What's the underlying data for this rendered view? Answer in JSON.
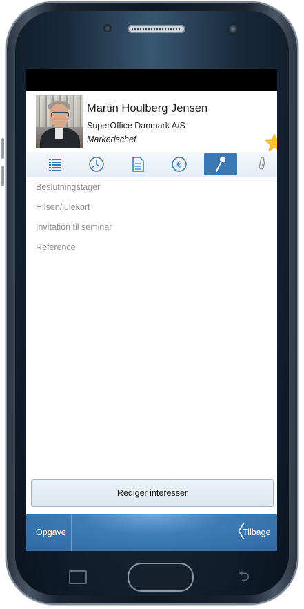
{
  "contact": {
    "name": "Martin Houlberg Jensen",
    "company": "SuperOffice Danmark A/S",
    "title": "Markedschef"
  },
  "tabs": [
    {
      "icon": "list-icon",
      "active": false
    },
    {
      "icon": "clock-icon",
      "active": false
    },
    {
      "icon": "document-icon",
      "active": false
    },
    {
      "icon": "euro-icon",
      "active": false
    },
    {
      "icon": "pin-icon",
      "active": true
    },
    {
      "icon": "paperclip-icon",
      "active": false
    }
  ],
  "interests": [
    "Beslutningstager",
    "Hilsen/julekort",
    "Invitation til seminar",
    "Reference"
  ],
  "edit_button": "Rediger interesser",
  "bottom_bar": {
    "task_label": "Opgave",
    "back_label": "Tilbage"
  },
  "colors": {
    "accent": "#3a78b5",
    "star": "#f7c333"
  }
}
